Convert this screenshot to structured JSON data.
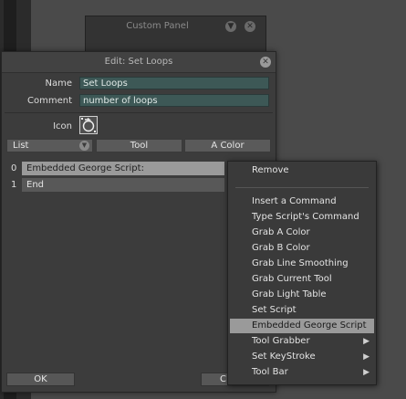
{
  "background_panel": {
    "title": "Custom Panel"
  },
  "dialog": {
    "title": "Edit: Set Loops",
    "name_label": "Name",
    "name_value": "Set Loops",
    "comment_label": "Comment",
    "comment_value": "number of loops",
    "icon_label": "Icon",
    "list_dropdown": "List",
    "header_tool": "Tool",
    "header_color": "A Color",
    "rows": [
      {
        "index": "0",
        "text": "Embedded George Script:"
      },
      {
        "index": "1",
        "text": "End"
      }
    ],
    "ok_label": "OK",
    "cancel_label": "C"
  },
  "context_menu": {
    "top_item": "Remove",
    "items": [
      {
        "label": "Insert a Command",
        "submenu": false,
        "selected": false
      },
      {
        "label": "Type Script's Command",
        "submenu": false,
        "selected": false
      },
      {
        "label": "Grab A Color",
        "submenu": false,
        "selected": false
      },
      {
        "label": "Grab B Color",
        "submenu": false,
        "selected": false
      },
      {
        "label": "Grab Line Smoothing",
        "submenu": false,
        "selected": false
      },
      {
        "label": "Grab Current Tool",
        "submenu": false,
        "selected": false
      },
      {
        "label": "Grab Light Table",
        "submenu": false,
        "selected": false
      },
      {
        "label": "Set Script",
        "submenu": false,
        "selected": false
      },
      {
        "label": "Embedded George Script",
        "submenu": false,
        "selected": true
      },
      {
        "label": "Tool Grabber",
        "submenu": true,
        "selected": false
      },
      {
        "label": "Set KeyStroke",
        "submenu": true,
        "selected": false
      },
      {
        "label": "Tool Bar",
        "submenu": true,
        "selected": false
      }
    ]
  },
  "icons": {
    "panel_minimize": "chevron-down-icon",
    "panel_close": "close-icon",
    "dialog_close": "close-icon",
    "loop_icon": "loop-icon",
    "submenu_arrow": "chevron-right-icon"
  },
  "colors": {
    "field_bg": "#3d5856",
    "selection_bg": "#9a9a9a"
  }
}
